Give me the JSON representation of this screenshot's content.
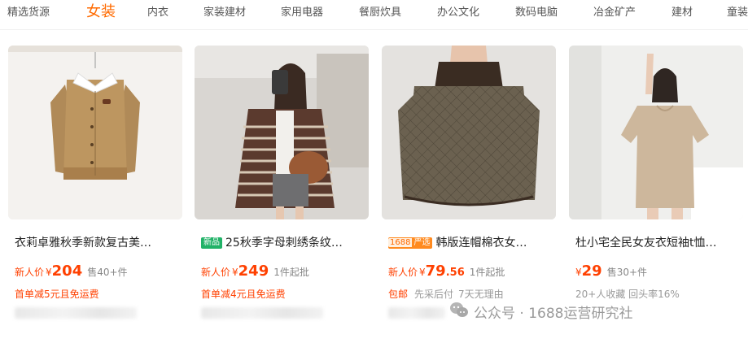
{
  "nav": {
    "items": [
      "精选货源",
      "女装",
      "内衣",
      "家装建材",
      "家用电器",
      "餐厨炊具",
      "办公文化",
      "数码电脑",
      "冶金矿产",
      "建材",
      "童装"
    ],
    "active_index": 1
  },
  "products": [
    {
      "title": "衣莉卓雅秋季新款复古美…",
      "badge": "",
      "price_label": "新人价",
      "currency": "¥",
      "price": "204",
      "price_decimal": "",
      "sales": "售40+件",
      "promo": "首单减5元且免运费"
    },
    {
      "title": "25秋季字母刺绣条纹…",
      "badge": "新品",
      "price_label": "新人价",
      "currency": "¥",
      "price": "249",
      "price_decimal": "",
      "sales": "1件起批",
      "promo": "首单减4元且免运费"
    },
    {
      "title": "韩版连帽棉衣女…",
      "badge_num": "1688",
      "badge": "严选",
      "price_label": "新人价",
      "currency": "¥",
      "price": "79",
      "price_decimal": ".56",
      "sales": "1件起批",
      "tags": [
        "包邮",
        "先采后付",
        "7天无理由"
      ]
    },
    {
      "title": "杜小宅全民女友衣短袖t恤…",
      "badge": "",
      "price_label": "",
      "currency": "¥",
      "price": "29",
      "price_decimal": "",
      "sales": "售30+件",
      "stats": "20+人收藏   回头率16%"
    }
  ],
  "watermark": "公众号 · 1688运营研究社",
  "colors": {
    "accent": "#ff6a00",
    "price": "#ff4000",
    "new_badge": "#21b267"
  }
}
